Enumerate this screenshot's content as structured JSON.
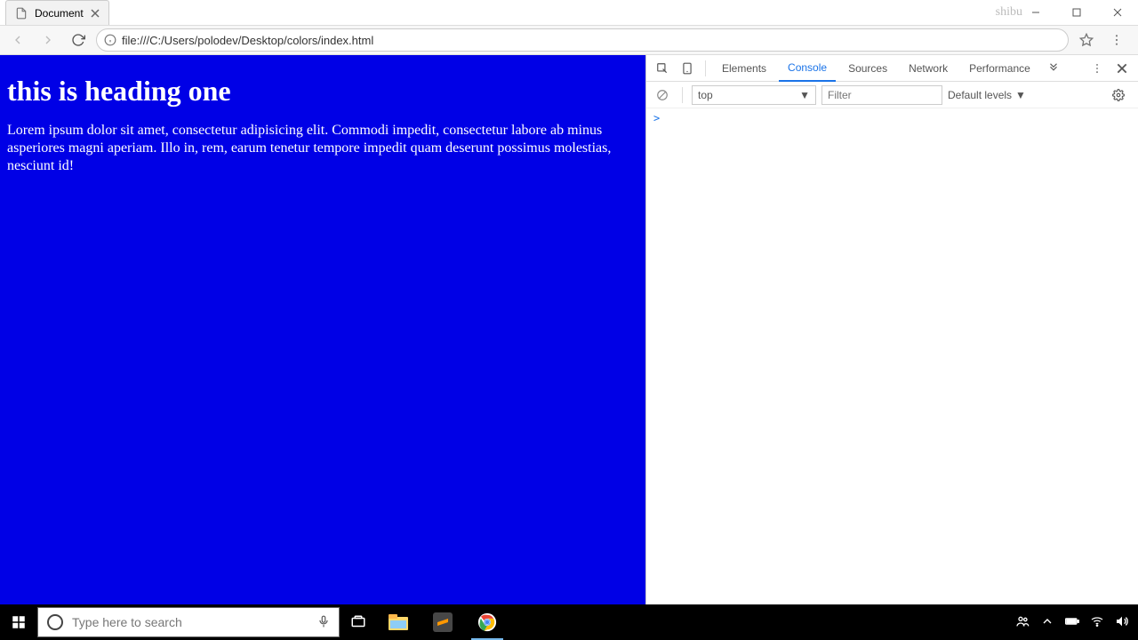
{
  "browser": {
    "tab_title": "Document",
    "watermark": "shibu",
    "url": "file:///C:/Users/polodev/Desktop/colors/index.html"
  },
  "page": {
    "heading": "this is heading one",
    "paragraph": "Lorem ipsum dolor sit amet, consectetur adipisicing elit. Commodi impedit, consectetur labore ab minus asperiores magni aperiam. Illo in, rem, earum tenetur tempore impedit quam deserunt possimus molestias, nesciunt id!",
    "bg_color": "#0000e6"
  },
  "devtools": {
    "tabs": [
      "Elements",
      "Console",
      "Sources",
      "Network",
      "Performance"
    ],
    "active_tab": "Console",
    "context_select": "top",
    "filter_placeholder": "Filter",
    "levels_label": "Default levels",
    "prompt": ">"
  },
  "taskbar": {
    "search_placeholder": "Type here to search"
  }
}
